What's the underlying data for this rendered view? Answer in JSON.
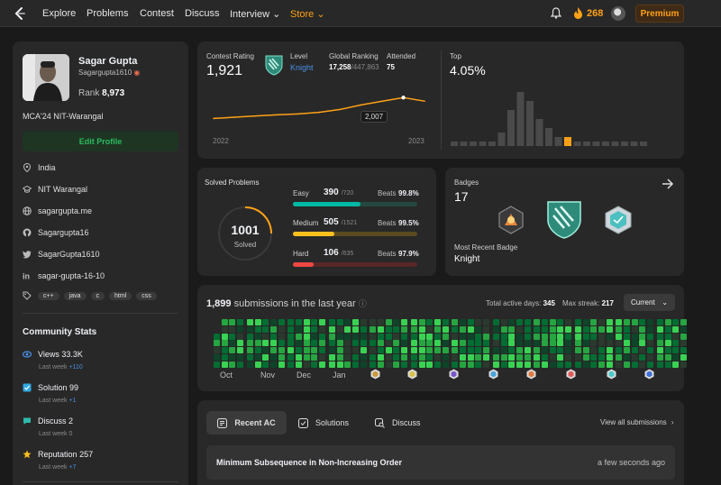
{
  "nav": {
    "items": [
      "Explore",
      "Problems",
      "Contest",
      "Discuss",
      "Interview ⌄",
      "Store ⌄"
    ],
    "streak": "268",
    "premium": "Premium"
  },
  "profile": {
    "name": "Sagar Gupta",
    "username": "Sagargupta1610",
    "rank_label": "Rank",
    "rank_value": "8,973",
    "bio": "MCA'24 NIT-Warangal",
    "edit_label": "Edit Profile",
    "location": "India",
    "school": "NIT Warangal",
    "website": "sagargupta.me",
    "github": "Sagargupta16",
    "twitter": "SagarGupta1610",
    "linkedin": "sagar-gupta-16-10",
    "skills": [
      "c++",
      "java",
      "c",
      "html",
      "css"
    ]
  },
  "community": {
    "title": "Community Stats",
    "items": [
      {
        "label": "Views",
        "value": "33.3K",
        "sub_label": "Last week",
        "sub_value": "+110",
        "color": "#4a8fe5"
      },
      {
        "label": "Solution",
        "value": "99",
        "sub_label": "Last week",
        "sub_value": "+1",
        "color": "#30a8e0"
      },
      {
        "label": "Discuss",
        "value": "2",
        "sub_label": "Last week",
        "sub_value": "0",
        "color": "#2cbbad"
      },
      {
        "label": "Reputation",
        "value": "257",
        "sub_label": "Last week",
        "sub_value": "+7",
        "color": "#ffc01e"
      }
    ]
  },
  "contest": {
    "rating_label": "Contest Rating",
    "rating": "1,921",
    "level_label": "Level",
    "level": "Knight",
    "global_label": "Global Ranking",
    "global_rank": "17,258",
    "global_total": "/447,863",
    "attended_label": "Attended",
    "attended": "75",
    "top_label": "Top",
    "top_value": "4.05%",
    "tooltip": "2,007",
    "year_start": "2022",
    "year_end": "2023"
  },
  "chart_data": {
    "type": "line",
    "x": [
      2022.0,
      2022.1,
      2022.2,
      2022.3,
      2022.4,
      2022.5,
      2022.6,
      2022.7,
      2022.8,
      2022.9,
      2023.0
    ],
    "series": [
      {
        "values": [
          1500,
          1530,
          1560,
          1590,
          1610,
          1650,
          1720,
          1830,
          1920,
          2007,
          1921
        ]
      }
    ],
    "xlabel": "",
    "ylabel": "",
    "tooltip_value": "2,007",
    "histogram": [
      1,
      1,
      1,
      1,
      1,
      3,
      8,
      12,
      10,
      6,
      4,
      2,
      2,
      1,
      1,
      1,
      1,
      1,
      1,
      1,
      1
    ],
    "histogram_highlight": 12
  },
  "solved": {
    "title": "Solved Problems",
    "total": "1001",
    "total_label": "Solved",
    "rows": [
      {
        "label": "Easy",
        "count": "390",
        "total": "/720",
        "beats_label": "Beats",
        "beats": "99.8%",
        "fraction": 0.54,
        "color": "#00b8a3",
        "bg": "#24483f"
      },
      {
        "label": "Medium",
        "count": "505",
        "total": "/1521",
        "beats_label": "Beats",
        "beats": "99.5%",
        "fraction": 0.33,
        "color": "#ffc01e",
        "bg": "#5a4a20"
      },
      {
        "label": "Hard",
        "count": "106",
        "total": "/635",
        "beats_label": "Beats",
        "beats": "97.9%",
        "fraction": 0.17,
        "color": "#ef4743",
        "bg": "#5a2626"
      }
    ]
  },
  "badges": {
    "title": "Badges",
    "count": "17",
    "recent_label": "Most Recent Badge",
    "recent": "Knight"
  },
  "submissions": {
    "count": "1,899",
    "label": "submissions in the last year",
    "active_label": "Total active days:",
    "active": "345",
    "streak_label": "Max streak:",
    "streak": "217",
    "dropdown": "Current",
    "months": [
      "Oct",
      "Nov",
      "Dec",
      "Jan"
    ]
  },
  "recent": {
    "tabs": [
      "Recent AC",
      "Solutions",
      "Discuss"
    ],
    "view_all": "View all submissions",
    "items": [
      {
        "title": "Minimum Subsequence in Non-Increasing Order",
        "time": "a few seconds ago"
      }
    ]
  }
}
